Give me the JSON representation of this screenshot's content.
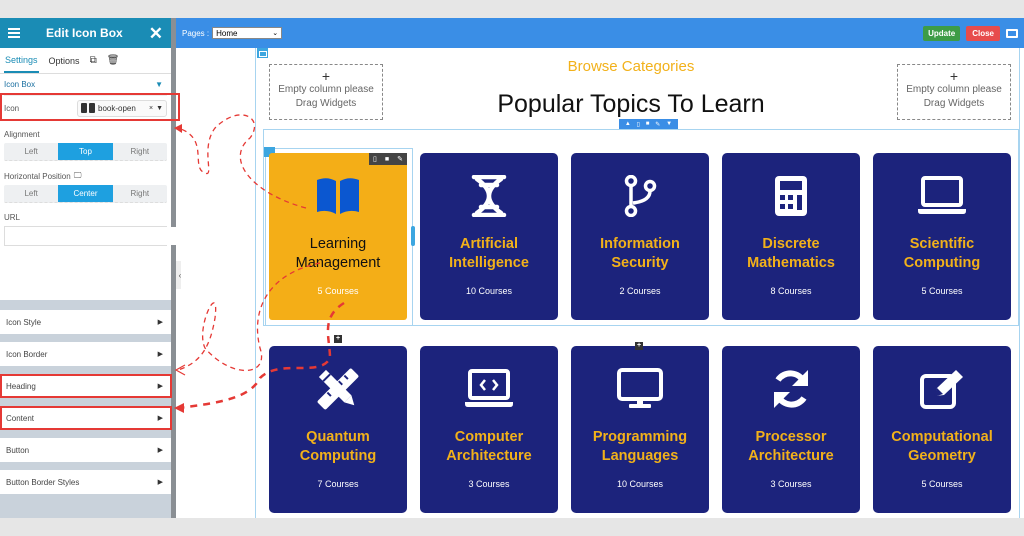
{
  "sidebar": {
    "title": "Edit Icon Box",
    "tabs": [
      {
        "label": "Settings",
        "active": true
      },
      {
        "label": "Options",
        "active": false
      }
    ],
    "section_title": "Icon Box",
    "icon_field": {
      "label": "Icon",
      "value": "book-open"
    },
    "alignment": {
      "label": "Alignment",
      "options": [
        "Left",
        "Top",
        "Right"
      ],
      "selected": "Top"
    },
    "horizontal_position": {
      "label": "Horizontal Position",
      "options": [
        "Left",
        "Center",
        "Right"
      ],
      "selected": "Center"
    },
    "url": {
      "label": "URL",
      "value": ""
    },
    "panels": [
      "Icon Style",
      "Icon Border",
      "Heading",
      "Content",
      "Button",
      "Button Border Styles"
    ],
    "highlighted_panels": [
      "Heading",
      "Content"
    ]
  },
  "topbar": {
    "pages_label": "Pages :",
    "pages_value": "Home",
    "update_label": "Update",
    "close_label": "Close"
  },
  "canvas": {
    "empty_column": {
      "plus": "+",
      "line1": "Empty column please",
      "line2": "Drag Widgets"
    },
    "subheading": "Browse Categories",
    "heading": "Popular Topics To Learn",
    "colors": {
      "card_bg": "#1c237c",
      "active_card_bg": "#f4ae17",
      "accent": "#f2b11a",
      "editor_blue": "#3a8ee6"
    },
    "cards": [
      {
        "title1": "Learning",
        "title2": "Management",
        "count": "5 Courses",
        "icon": "book-open-icon",
        "active": true
      },
      {
        "title1": "Artificial",
        "title2": "Intelligence",
        "count": "10 Courses",
        "icon": "dna-icon"
      },
      {
        "title1": "Information",
        "title2": "Security",
        "count": "2 Courses",
        "icon": "code-branch-icon"
      },
      {
        "title1": "Discrete",
        "title2": "Mathematics",
        "count": "8 Courses",
        "icon": "calculator-icon"
      },
      {
        "title1": "Scientific",
        "title2": "Computing",
        "count": "5 Courses",
        "icon": "laptop-icon"
      },
      {
        "title1": "Quantum",
        "title2": "Computing",
        "count": "7 Courses",
        "icon": "pencil-ruler-icon"
      },
      {
        "title1": "Computer",
        "title2": "Architecture",
        "count": "3 Courses",
        "icon": "laptop-code-icon"
      },
      {
        "title1": "Programming",
        "title2": "Languages",
        "count": "10 Courses",
        "icon": "desktop-icon"
      },
      {
        "title1": "Processor",
        "title2": "Architecture",
        "count": "3 Courses",
        "icon": "sync-icon"
      },
      {
        "title1": "Computational",
        "title2": "Geometry",
        "count": "5 Courses",
        "icon": "edit-icon"
      }
    ]
  }
}
